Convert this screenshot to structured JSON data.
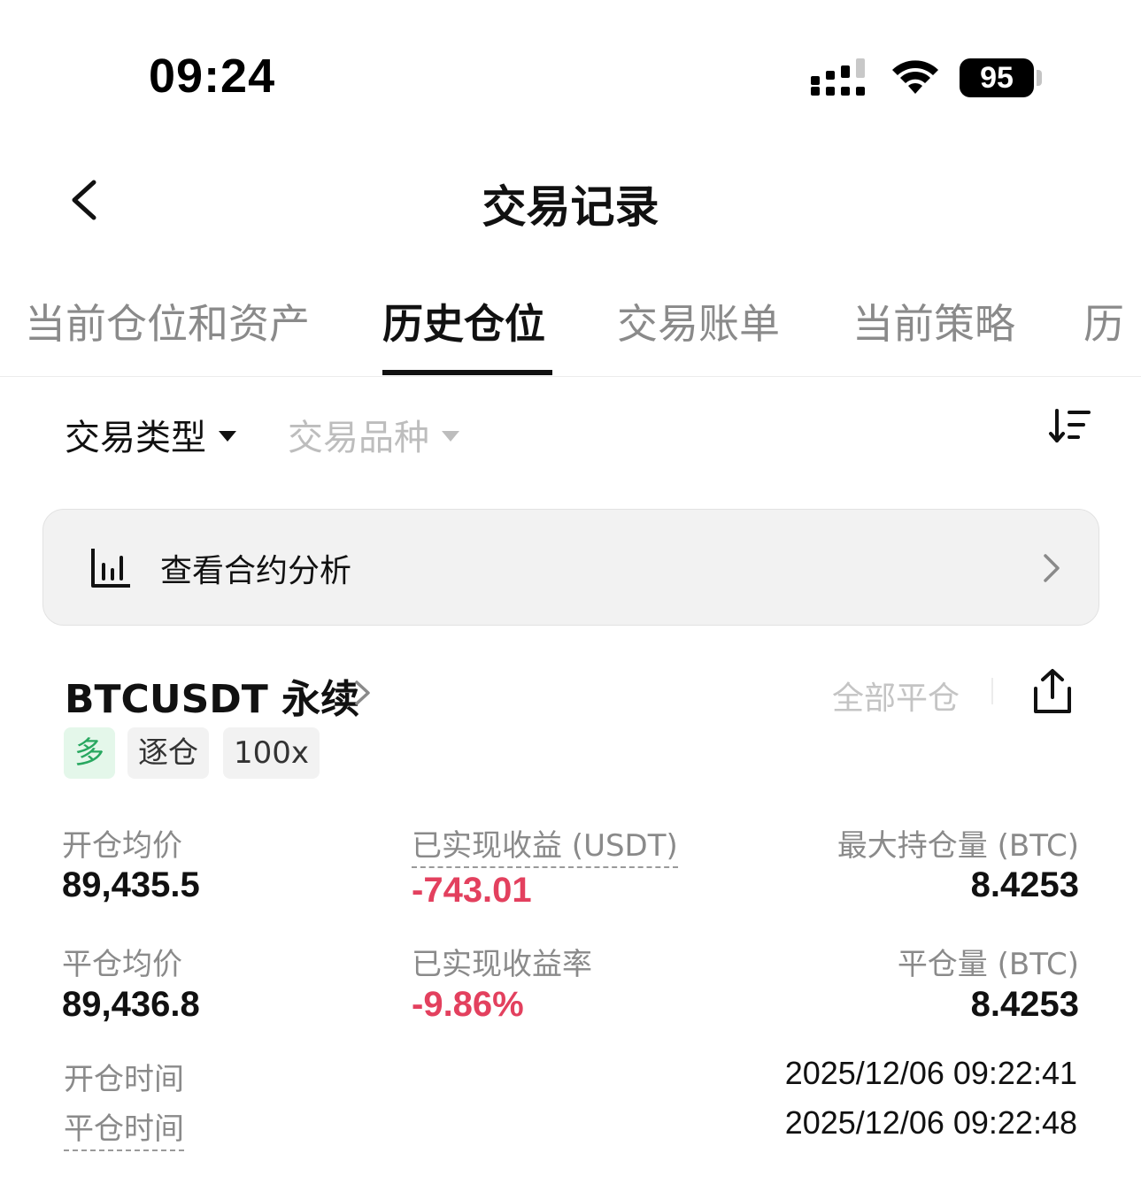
{
  "status_bar": {
    "time": "09:24",
    "battery": "95"
  },
  "header": {
    "title": "交易记录"
  },
  "tabs": [
    {
      "label": "当前仓位和资产",
      "active": false
    },
    {
      "label": "历史仓位",
      "active": true
    },
    {
      "label": "交易账单",
      "active": false
    },
    {
      "label": "当前策略",
      "active": false
    },
    {
      "label": "历",
      "active": false
    }
  ],
  "filters": {
    "trade_type": "交易类型",
    "instrument": "交易品种"
  },
  "analysis": {
    "label": "查看合约分析"
  },
  "position": {
    "symbol": "BTCUSDT 永续",
    "close_all": "全部平仓",
    "tags": {
      "side": "多",
      "margin_mode": "逐仓",
      "leverage": "100x"
    },
    "open_avg_label": "开仓均价",
    "open_avg": "89,435.5",
    "realized_pnl_label": "已实现收益 (USDT)",
    "realized_pnl": "-743.01",
    "max_size_label": "最大持仓量 (BTC)",
    "max_size": "8.4253",
    "close_avg_label": "平仓均价",
    "close_avg": "89,436.8",
    "realized_rate_label": "已实现收益率",
    "realized_rate": "-9.86%",
    "closed_size_label": "平仓量 (BTC)",
    "closed_size": "8.4253",
    "open_time_label": "开仓时间",
    "open_time": "2025/12/06 09:22:41",
    "close_time_label": "平仓时间",
    "close_time": "2025/12/06 09:22:48"
  },
  "colors": {
    "loss": "#e3405e",
    "long_tag_text": "#28a860",
    "long_tag_bg": "#e4f7ea"
  }
}
